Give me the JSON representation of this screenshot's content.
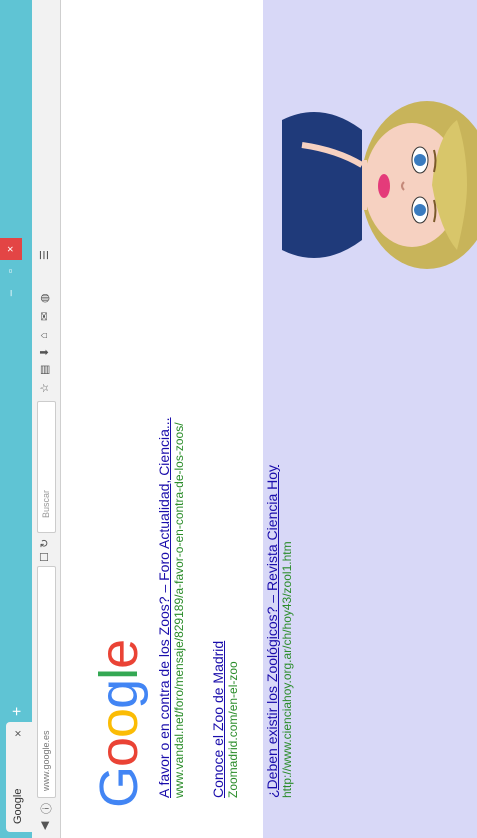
{
  "browser": {
    "tab_title": "Google",
    "tab_close": "×",
    "new_tab": "+",
    "url": "www.google.es",
    "search_placeholder": "Buscar"
  },
  "page": {
    "logo": [
      "G",
      "o",
      "o",
      "g",
      "l",
      "e"
    ]
  },
  "results": [
    {
      "title": "A favor o en contra de los Zoos? – Foro Actualidad, Ciencia...",
      "url": "www.vandal.net/foro/mensaje/829189/a-favor-o-en-contra-de-los-zoos/"
    },
    {
      "title": "Conoce el Zoo de Madrid",
      "url": "Zoomadrid.com/en-el-zoo"
    },
    {
      "title": "¿Deben existir los Zoológicos? – Revista Ciencia Hoy",
      "url": "http://www.cienciahoy.org.ar/ch/hoy43/zool1.htm"
    }
  ],
  "colors": {
    "panel_bg": "#d8d8f7",
    "question_mark": "#ff1a1a"
  },
  "icons": [
    "back-icon",
    "reload-icon",
    "search-icon",
    "star-icon",
    "clipboard-icon",
    "download-icon",
    "home-icon",
    "chat-icon",
    "shield-icon",
    "menu-icon"
  ]
}
